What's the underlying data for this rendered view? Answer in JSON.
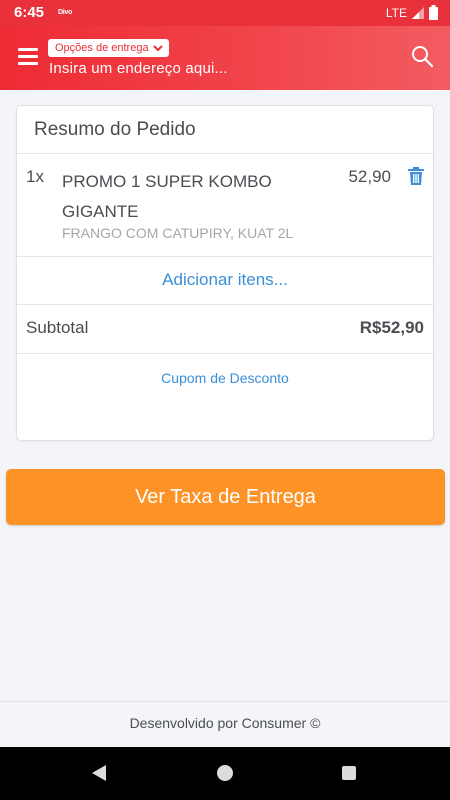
{
  "status_bar": {
    "time": "6:45",
    "app_badge": "Divo",
    "network": "LTE"
  },
  "header": {
    "delivery_options_label": "Opções de entrega",
    "address_placeholder": "Insira um endereço aqui..."
  },
  "order_summary": {
    "title": "Resumo do Pedido",
    "items": [
      {
        "quantity": "1x",
        "name": "PROMO 1 SUPER KOMBO GIGANTE",
        "description": "FRANGO COM CATUPIRY, KUAT 2L",
        "price": "52,90"
      }
    ],
    "add_items_label": "Adicionar itens...",
    "subtotal_label": "Subtotal",
    "subtotal_value": "R$52,90",
    "coupon_label": "Cupom de Desconto"
  },
  "cta": {
    "label": "Ver Taxa de Entrega"
  },
  "footer": {
    "text": "Desenvolvido por Consumer ©"
  },
  "icons": {
    "menu": "hamburger-menu-icon",
    "search": "search-icon",
    "trash": "trash-icon",
    "chevron": "chevron-down-icon"
  },
  "colors": {
    "brand_red": "#e8313a",
    "accent_orange": "#fd9227",
    "link_blue": "#3b8fd8",
    "text_dark": "#4a4d52",
    "text_muted": "#a3a7ad",
    "page_bg": "#f4f5f9"
  }
}
